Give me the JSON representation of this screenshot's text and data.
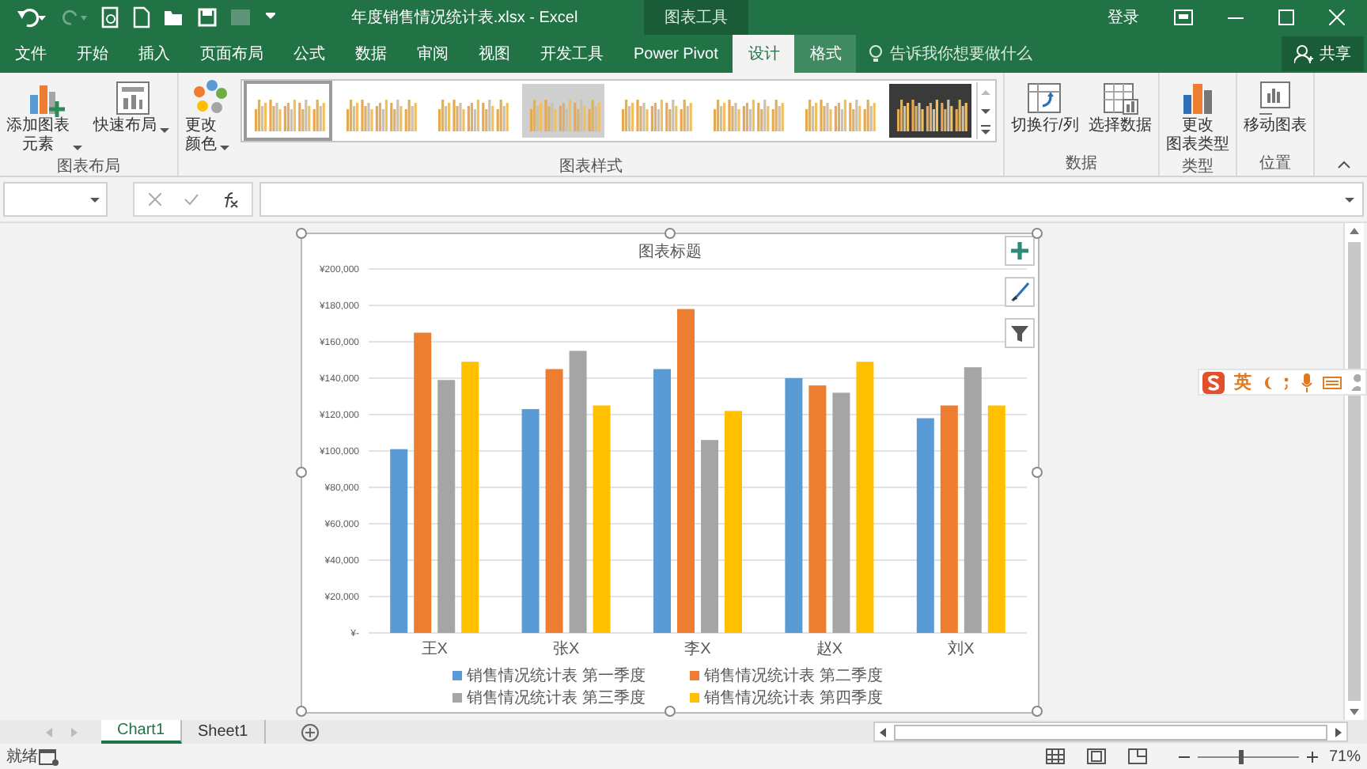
{
  "window": {
    "title": "年度销售情况统计表.xlsx  -  Excel",
    "contextual_group": "图表工具",
    "sign_in": "登录"
  },
  "ribbon_tabs": [
    {
      "label": "文件",
      "selected": false,
      "hovered": false
    },
    {
      "label": "开始",
      "selected": false,
      "hovered": false
    },
    {
      "label": "插入",
      "selected": false,
      "hovered": false
    },
    {
      "label": "页面布局",
      "selected": false,
      "hovered": false
    },
    {
      "label": "公式",
      "selected": false,
      "hovered": false
    },
    {
      "label": "数据",
      "selected": false,
      "hovered": false
    },
    {
      "label": "审阅",
      "selected": false,
      "hovered": false
    },
    {
      "label": "视图",
      "selected": false,
      "hovered": false
    },
    {
      "label": "开发工具",
      "selected": false,
      "hovered": false
    },
    {
      "label": "Power Pivot",
      "selected": false,
      "hovered": false
    },
    {
      "label": "设计",
      "selected": true,
      "hovered": false
    },
    {
      "label": "格式",
      "selected": false,
      "hovered": true
    }
  ],
  "tell_me": {
    "placeholder": "告诉我你想要做什么"
  },
  "share_button": "共享",
  "ribbon": {
    "groups": [
      {
        "label": "图表布局",
        "commands": [
          {
            "label": "添加图表元素",
            "dropdown": true
          },
          {
            "label": "快速布局",
            "dropdown": true
          }
        ]
      },
      {
        "label": "图表样式",
        "commands": [
          {
            "label": "更改颜色",
            "dropdown": true
          }
        ],
        "styles": [
          {
            "kind": "light",
            "selected": true
          },
          {
            "kind": "light",
            "selected": false
          },
          {
            "kind": "light",
            "selected": false
          },
          {
            "kind": "gray",
            "selected": false
          },
          {
            "kind": "light",
            "selected": false
          },
          {
            "kind": "light",
            "selected": false
          },
          {
            "kind": "light",
            "selected": false
          },
          {
            "kind": "dark",
            "selected": false
          }
        ]
      },
      {
        "label": "数据",
        "commands": [
          {
            "label": "切换行/列",
            "dropdown": false
          },
          {
            "label": "选择数据",
            "dropdown": false
          }
        ]
      },
      {
        "label": "类型",
        "commands": [
          {
            "label": "更改图表类型",
            "dropdown": false
          }
        ]
      },
      {
        "label": "位置",
        "commands": [
          {
            "label": "移动图表",
            "dropdown": false
          }
        ]
      }
    ]
  },
  "chart": {
    "chart_data": {
      "type": "bar",
      "title": "图表标题",
      "grid": true,
      "legend": "bottom",
      "categories": [
        "王X",
        "张X",
        "李X",
        "赵X",
        "刘X"
      ],
      "series": [
        {
          "name": "销售情况统计表 第一季度",
          "color": "#5b9bd5",
          "values": [
            101000,
            123000,
            145000,
            140000,
            118000
          ]
        },
        {
          "name": "销售情况统计表 第二季度",
          "color": "#ed7d31",
          "values": [
            165000,
            145000,
            178000,
            136000,
            125000
          ]
        },
        {
          "name": "销售情况统计表 第三季度",
          "color": "#a5a5a5",
          "values": [
            139000,
            155000,
            106000,
            132000,
            146000
          ]
        },
        {
          "name": "销售情况统计表 第四季度",
          "color": "#ffc000",
          "values": [
            149000,
            125000,
            122000,
            149000,
            125000
          ]
        }
      ],
      "ylim": [
        0,
        200000
      ],
      "yticks": [
        {
          "value": 0,
          "label": "¥-"
        },
        {
          "value": 20000,
          "label": "¥20,000"
        },
        {
          "value": 40000,
          "label": "¥40,000"
        },
        {
          "value": 60000,
          "label": "¥60,000"
        },
        {
          "value": 80000,
          "label": "¥80,000"
        },
        {
          "value": 100000,
          "label": "¥100,000"
        },
        {
          "value": 120000,
          "label": "¥120,000"
        },
        {
          "value": 140000,
          "label": "¥140,000"
        },
        {
          "value": 160000,
          "label": "¥160,000"
        },
        {
          "value": 180000,
          "label": "¥180,000"
        },
        {
          "value": 200000,
          "label": "¥200,000"
        }
      ]
    }
  },
  "ime_bar": {
    "mode": "英"
  },
  "sheet_tabs": [
    {
      "label": "Chart1",
      "selected": true
    },
    {
      "label": "Sheet1",
      "selected": false
    }
  ],
  "status_bar": {
    "status": "就绪",
    "zoom_slider": {
      "level": 0.43
    },
    "zoom": "71%"
  }
}
